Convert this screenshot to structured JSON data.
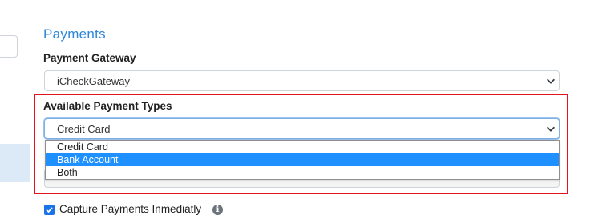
{
  "payments": {
    "title": "Payments",
    "gateway_label": "Payment Gateway",
    "gateway_value": "iCheckGateway",
    "types_label": "Available Payment Types",
    "types_value": "Credit Card",
    "types_options": [
      "Credit Card",
      "Bank Account",
      "Both"
    ],
    "types_highlighted_option": "Bank Account",
    "capture_label": "Capture Payments Inmediatly",
    "capture_checked": true,
    "info_icon": "i"
  },
  "colors": {
    "title": "#2f86d9",
    "highlight_border": "#e4141c",
    "option_highlight": "#1e90ff",
    "checkbox": "#1a73e8"
  }
}
